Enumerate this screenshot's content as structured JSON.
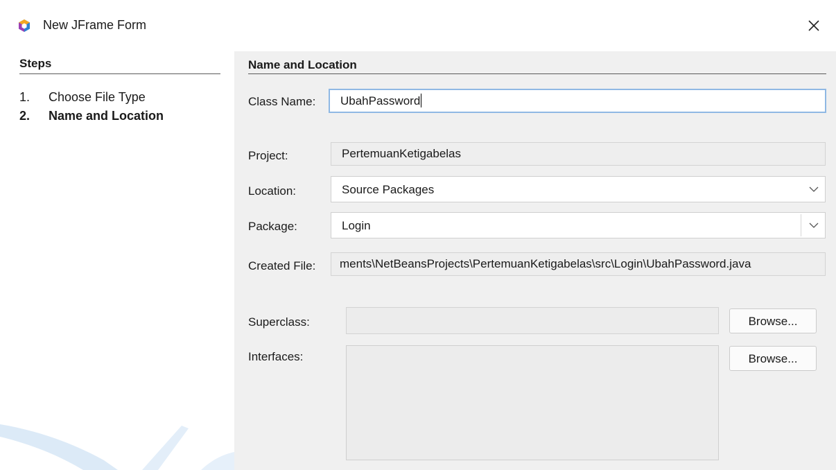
{
  "window": {
    "title": "New JFrame Form",
    "icon": "netbeans-cube-icon",
    "close_icon": "close-icon"
  },
  "steps": {
    "title": "Steps",
    "items": [
      {
        "num": "1.",
        "label": "Choose File Type",
        "current": false
      },
      {
        "num": "2.",
        "label": "Name and Location",
        "current": true
      }
    ]
  },
  "form": {
    "section_title": "Name and Location",
    "class_name": {
      "label": "Class Name:",
      "value": "UbahPassword"
    },
    "project": {
      "label": "Project:",
      "value": "PertemuanKetigabelas"
    },
    "location": {
      "label": "Location:",
      "value": "Source Packages"
    },
    "package": {
      "label": "Package:",
      "value": "Login"
    },
    "created_file": {
      "label": "Created File:",
      "value": "ments\\NetBeansProjects\\PertemuanKetigabelas\\src\\Login\\UbahPassword.java"
    },
    "superclass": {
      "label": "Superclass:",
      "value": "",
      "browse_label": "Browse..."
    },
    "interfaces": {
      "label": "Interfaces:",
      "browse_label": "Browse..."
    }
  },
  "colors": {
    "focus_border": "#8fb8e4",
    "content_bg": "#f0f0f0",
    "swoosh": "#dbe9f7"
  }
}
